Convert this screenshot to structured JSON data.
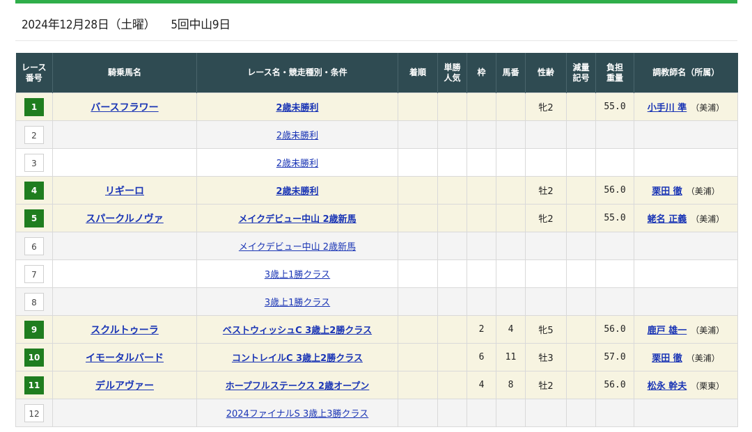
{
  "header": {
    "date": "2024年12月28日（土曜）",
    "meeting": "5回中山9日"
  },
  "columns": [
    "レース\n番号",
    "騎乗馬名",
    "レース名・競走種別・条件",
    "着順",
    "単勝\n人気",
    "枠",
    "馬番",
    "性齢",
    "減量\n記号",
    "負担\n重量",
    "調教師名（所属）"
  ],
  "rows": [
    {
      "race_no": "1",
      "horse": "バースフラワー",
      "race": "2歳未勝利",
      "rank": "",
      "pop": "",
      "waku": "",
      "umaban": "",
      "sexage": "牝2",
      "gen": "",
      "weight": "55.0",
      "trainer": "小手川 準",
      "loc": "（美浦）",
      "highlight": true
    },
    {
      "race_no": "2",
      "horse": "",
      "race": "2歳未勝利",
      "rank": "",
      "pop": "",
      "waku": "",
      "umaban": "",
      "sexage": "",
      "gen": "",
      "weight": "",
      "trainer": "",
      "loc": "",
      "highlight": false
    },
    {
      "race_no": "3",
      "horse": "",
      "race": "2歳未勝利",
      "rank": "",
      "pop": "",
      "waku": "",
      "umaban": "",
      "sexage": "",
      "gen": "",
      "weight": "",
      "trainer": "",
      "loc": "",
      "highlight": false
    },
    {
      "race_no": "4",
      "horse": "リギーロ",
      "race": "2歳未勝利",
      "rank": "",
      "pop": "",
      "waku": "",
      "umaban": "",
      "sexage": "牡2",
      "gen": "",
      "weight": "56.0",
      "trainer": "栗田 徹",
      "loc": "（美浦）",
      "highlight": true
    },
    {
      "race_no": "5",
      "horse": "スパークルノヴァ",
      "race": "メイクデビュー中山 2歳新馬",
      "rank": "",
      "pop": "",
      "waku": "",
      "umaban": "",
      "sexage": "牝2",
      "gen": "",
      "weight": "55.0",
      "trainer": "蛯名 正義",
      "loc": "（美浦）",
      "highlight": true
    },
    {
      "race_no": "6",
      "horse": "",
      "race": "メイクデビュー中山 2歳新馬",
      "rank": "",
      "pop": "",
      "waku": "",
      "umaban": "",
      "sexage": "",
      "gen": "",
      "weight": "",
      "trainer": "",
      "loc": "",
      "highlight": false
    },
    {
      "race_no": "7",
      "horse": "",
      "race": "3歳上1勝クラス",
      "rank": "",
      "pop": "",
      "waku": "",
      "umaban": "",
      "sexage": "",
      "gen": "",
      "weight": "",
      "trainer": "",
      "loc": "",
      "highlight": false
    },
    {
      "race_no": "8",
      "horse": "",
      "race": "3歳上1勝クラス",
      "rank": "",
      "pop": "",
      "waku": "",
      "umaban": "",
      "sexage": "",
      "gen": "",
      "weight": "",
      "trainer": "",
      "loc": "",
      "highlight": false
    },
    {
      "race_no": "9",
      "horse": "スクルトゥーラ",
      "race": "ベストウィッシュC 3歳上2勝クラス",
      "rank": "",
      "pop": "",
      "waku": "2",
      "umaban": "4",
      "sexage": "牝5",
      "gen": "",
      "weight": "56.0",
      "trainer": "鹿戸 雄一",
      "loc": "（美浦）",
      "highlight": true
    },
    {
      "race_no": "10",
      "horse": "イモータルバード",
      "race": "コントレイルC 3歳上2勝クラス",
      "rank": "",
      "pop": "",
      "waku": "6",
      "umaban": "11",
      "sexage": "牡3",
      "gen": "",
      "weight": "57.0",
      "trainer": "栗田 徹",
      "loc": "（美浦）",
      "highlight": true
    },
    {
      "race_no": "11",
      "horse": "デルアヴァー",
      "race": "ホープフルステークス 2歳オープン",
      "rank": "",
      "pop": "",
      "waku": "4",
      "umaban": "8",
      "sexage": "牡2",
      "gen": "",
      "weight": "56.0",
      "trainer": "松永 幹夫",
      "loc": "（栗東）",
      "highlight": true
    },
    {
      "race_no": "12",
      "horse": "",
      "race": "2024ファイナルS 3歳上3勝クラス",
      "rank": "",
      "pop": "",
      "waku": "",
      "umaban": "",
      "sexage": "",
      "gen": "",
      "weight": "",
      "trainer": "",
      "loc": "",
      "highlight": false
    }
  ]
}
